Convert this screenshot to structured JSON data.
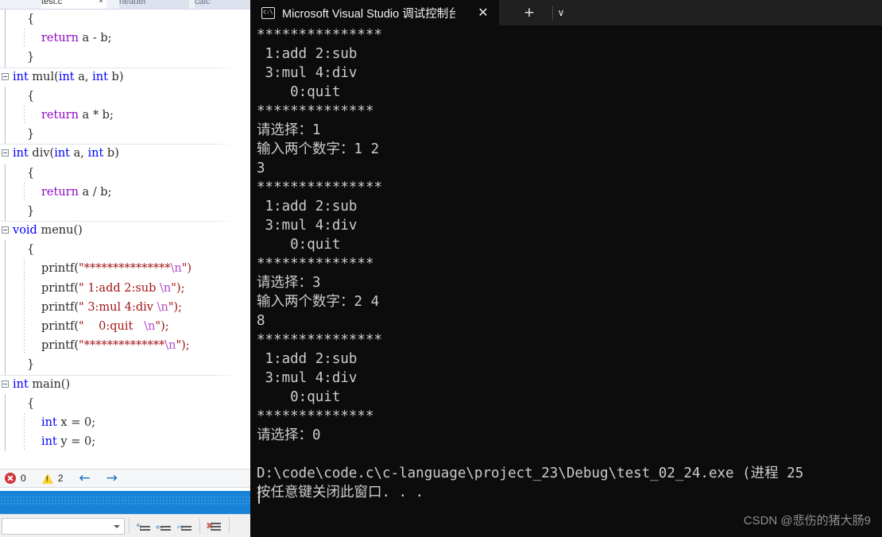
{
  "editor": {
    "tabs": [
      {
        "label": "test.c",
        "active": true
      },
      {
        "label": "header",
        "active": false
      },
      {
        "label": "calc",
        "active": false
      }
    ],
    "code_lines": [
      {
        "indent": 1,
        "fold": false,
        "tokens": [
          {
            "t": "{",
            "c": "punc"
          }
        ]
      },
      {
        "indent": 2,
        "fold": false,
        "tokens": [
          {
            "t": "return",
            "c": "ctl"
          },
          {
            "t": " a - b;",
            "c": "id"
          }
        ]
      },
      {
        "indent": 1,
        "fold": false,
        "tokens": [
          {
            "t": "}",
            "c": "punc"
          }
        ]
      },
      {
        "indent": 0,
        "fold": true,
        "tokens": [
          {
            "t": "int",
            "c": "kw"
          },
          {
            "t": " mul(",
            "c": "id"
          },
          {
            "t": "int",
            "c": "kw"
          },
          {
            "t": " a, ",
            "c": "id"
          },
          {
            "t": "int",
            "c": "kw"
          },
          {
            "t": " b)",
            "c": "id"
          }
        ]
      },
      {
        "indent": 1,
        "fold": false,
        "tokens": [
          {
            "t": "{",
            "c": "punc"
          }
        ]
      },
      {
        "indent": 2,
        "fold": false,
        "tokens": [
          {
            "t": "return",
            "c": "ctl"
          },
          {
            "t": " a * b;",
            "c": "id"
          }
        ]
      },
      {
        "indent": 1,
        "fold": false,
        "tokens": [
          {
            "t": "}",
            "c": "punc"
          }
        ]
      },
      {
        "indent": 0,
        "fold": true,
        "tokens": [
          {
            "t": "int",
            "c": "kw"
          },
          {
            "t": " div(",
            "c": "id"
          },
          {
            "t": "int",
            "c": "kw"
          },
          {
            "t": " a, ",
            "c": "id"
          },
          {
            "t": "int",
            "c": "kw"
          },
          {
            "t": " b)",
            "c": "id"
          }
        ]
      },
      {
        "indent": 1,
        "fold": false,
        "tokens": [
          {
            "t": "{",
            "c": "punc"
          }
        ]
      },
      {
        "indent": 2,
        "fold": false,
        "tokens": [
          {
            "t": "return",
            "c": "ctl"
          },
          {
            "t": " a / b;",
            "c": "id"
          }
        ]
      },
      {
        "indent": 1,
        "fold": false,
        "tokens": [
          {
            "t": "}",
            "c": "punc"
          }
        ]
      },
      {
        "indent": 0,
        "fold": true,
        "tokens": [
          {
            "t": "void",
            "c": "kw"
          },
          {
            "t": " menu()",
            "c": "id"
          }
        ]
      },
      {
        "indent": 1,
        "fold": false,
        "tokens": [
          {
            "t": "{",
            "c": "punc"
          }
        ]
      },
      {
        "indent": 2,
        "fold": false,
        "tokens": [
          {
            "t": "printf(",
            "c": "id"
          },
          {
            "t": "\"***************",
            "c": "str"
          },
          {
            "t": "\\n",
            "c": "esc"
          },
          {
            "t": "\")",
            "c": "str"
          }
        ]
      },
      {
        "indent": 2,
        "fold": false,
        "tokens": [
          {
            "t": "printf(",
            "c": "id"
          },
          {
            "t": "\" 1:add 2:sub ",
            "c": "str"
          },
          {
            "t": "\\n",
            "c": "esc"
          },
          {
            "t": "\");",
            "c": "str"
          }
        ]
      },
      {
        "indent": 2,
        "fold": false,
        "tokens": [
          {
            "t": "printf(",
            "c": "id"
          },
          {
            "t": "\" 3:mul 4:div ",
            "c": "str"
          },
          {
            "t": "\\n",
            "c": "esc"
          },
          {
            "t": "\");",
            "c": "str"
          }
        ]
      },
      {
        "indent": 2,
        "fold": false,
        "tokens": [
          {
            "t": "printf(",
            "c": "id"
          },
          {
            "t": "\"    0:quit   ",
            "c": "str"
          },
          {
            "t": "\\n",
            "c": "esc"
          },
          {
            "t": "\");",
            "c": "str"
          }
        ]
      },
      {
        "indent": 2,
        "fold": false,
        "tokens": [
          {
            "t": "printf(",
            "c": "id"
          },
          {
            "t": "\"**************",
            "c": "str"
          },
          {
            "t": "\\n",
            "c": "esc"
          },
          {
            "t": "\");",
            "c": "str"
          }
        ]
      },
      {
        "indent": 1,
        "fold": false,
        "tokens": [
          {
            "t": "}",
            "c": "punc"
          }
        ]
      },
      {
        "indent": 0,
        "fold": true,
        "tokens": [
          {
            "t": "int",
            "c": "kw"
          },
          {
            "t": " main()",
            "c": "id"
          }
        ]
      },
      {
        "indent": 1,
        "fold": false,
        "tokens": [
          {
            "t": "{",
            "c": "punc"
          }
        ]
      },
      {
        "indent": 2,
        "fold": false,
        "tokens": [
          {
            "t": "int",
            "c": "kw"
          },
          {
            "t": " x = 0;",
            "c": "id"
          }
        ]
      },
      {
        "indent": 2,
        "fold": false,
        "tokens": [
          {
            "t": "int",
            "c": "kw"
          },
          {
            "t": " y = 0;",
            "c": "id"
          }
        ]
      }
    ],
    "status": {
      "error_count": "0",
      "warning_count": "2",
      "back_arrow": "←",
      "forward_arrow": "→"
    },
    "bottom_toolbar": {
      "combo_value": "",
      "icons": [
        "uncomment-icon",
        "outdent-icon",
        "indent-icon",
        "clear-all-icon"
      ]
    }
  },
  "terminal": {
    "tab_title": "Microsoft Visual Studio 调试控制台",
    "icon": "console-cmd-icon",
    "close_label": "✕",
    "new_tab_label": "+",
    "menu_label": "∨",
    "lines": [
      "***************",
      " 1:add 2:sub",
      " 3:mul 4:div",
      "    0:quit",
      "**************",
      "请选择：1",
      "输入两个数字：1 2",
      "3",
      "***************",
      " 1:add 2:sub",
      " 3:mul 4:div",
      "    0:quit",
      "**************",
      "请选择：3",
      "输入两个数字：2 4",
      "8",
      "***************",
      " 1:add 2:sub",
      " 3:mul 4:div",
      "    0:quit",
      "**************",
      "请选择：0",
      "",
      "D:\\code\\code.c\\c-language\\project_23\\Debug\\test_02_24.exe (进程 25",
      "按任意键关闭此窗口. . ."
    ],
    "watermark": "CSDN @悲伤的猪大肠9"
  }
}
